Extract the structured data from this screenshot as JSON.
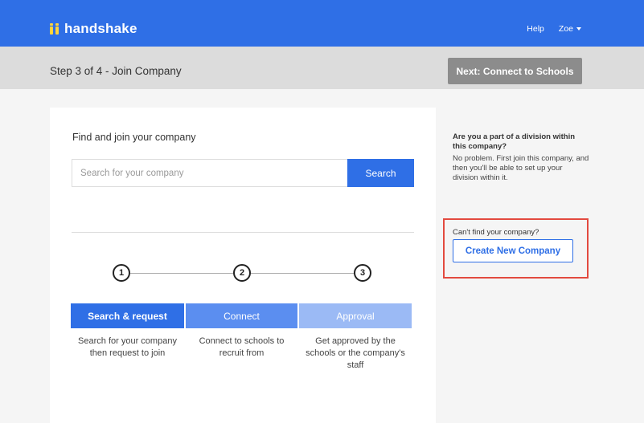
{
  "app": {
    "brand": "handshake"
  },
  "nav": {
    "help": "Help",
    "user": "Zoe"
  },
  "step": {
    "title": "Step 3 of 4 - Join Company",
    "next_label": "Next: Connect to Schools"
  },
  "main": {
    "find_label": "Find and join your company",
    "search_placeholder": "Search for your company",
    "search_button": "Search",
    "steps": [
      {
        "number": "1",
        "label": "Search & request",
        "description": "Search for your company then request to join"
      },
      {
        "number": "2",
        "label": "Connect",
        "description": "Connect to schools to recruit from"
      },
      {
        "number": "3",
        "label": "Approval",
        "description": "Get approved by the schools or the company's staff"
      }
    ]
  },
  "sidebar": {
    "division_question": "Are you a part of a division within this company?",
    "division_answer": "No problem. First join this company, and then you'll be able to set up your division within it.",
    "cant_find": "Can't find your company?",
    "create_button": "Create New Company"
  },
  "colors": {
    "brand_blue": "#2f6fe6",
    "logo_yellow": "#ffd43b",
    "highlight_red": "#e34a3f"
  }
}
